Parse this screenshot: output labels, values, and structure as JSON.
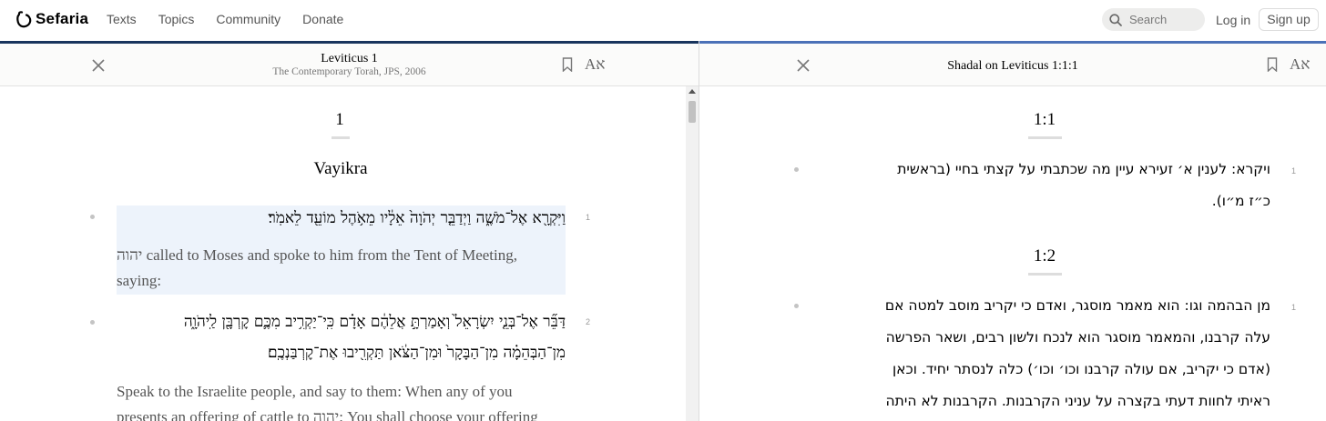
{
  "header": {
    "logo_text": "Sefaria",
    "nav": [
      "Texts",
      "Topics",
      "Community",
      "Donate"
    ],
    "search_placeholder": "Search",
    "login": "Log in",
    "signup": "Sign up"
  },
  "colors": {
    "left_panel_bar": "#18345d",
    "right_panel_bar": "#4b71b7",
    "highlight": "#edf3fb"
  },
  "left_panel": {
    "title": "Leviticus 1",
    "subtitle": "The Contemporary Torah, JPS, 2006",
    "font_toggle": "Aא",
    "section_number": "1",
    "chapter_title": "Vayikra",
    "verses": [
      {
        "num": "1",
        "hebrew": "וַיִּקְרָ֖א אֶל־מֹשֶׁ֑ה וַיְדַבֵּ֤ר יְהֹוָה֙ אֵלָ֔יו מֵאֹ֥הֶל מוֹעֵ֖ד לֵאמֹֽר׃",
        "english_line1": "יהוה called to Moses and spoke to him from the Tent of Meeting,",
        "english_line2": "saying:"
      },
      {
        "num": "2",
        "hebrew_line1": "דַּבֵּ֞ר אֶל־בְּנֵ֤י יִשְׂרָאֵל֙ וְאָמַרְתָּ֣ אֲלֵהֶ֔ם אָדָ֗ם כִּֽי־יַקְרִ֥יב מִכֶּ֛ם קׇרְבָּ֖ן לַֽיהֹוָ֑ה",
        "hebrew_line2": "מִן־הַבְּהֵמָ֗ה מִן־הַבָּקָר֙ וּמִן־הַצֹּ֔אן תַּקְרִ֖יבוּ אֶת־קׇרְבַּנְכֶֽם׃",
        "english_line1": "Speak to the Israelite people, and say to them: When any of you",
        "english_line2": "presents an offering of cattle to יהוה: You shall choose your offering"
      }
    ]
  },
  "right_panel": {
    "title": "Shadal on Leviticus 1:1:1",
    "font_toggle": "Aא",
    "sections": [
      {
        "label": "1:1",
        "comments": [
          {
            "num": "1",
            "line1": "ויקרא: לענין א׳ זעירא עיין מה שכתבתי על קצתי בחיי (בראשית",
            "line2": "כ״ז מ״ו)."
          }
        ]
      },
      {
        "label": "1:2",
        "comments": [
          {
            "num": "1",
            "line1": "מן הבהמה וגו: הוא מאמר מוסגר, ואדם כי יקריב מוסב למטה אם",
            "line2": "עלה קרבנו, והמאמר מוסגר הוא לנכח ולשון רבים, ושאר הפרשה",
            "line3": "(אדם כי יקריב, אם עולה קרבנו וכו׳ וכו׳) כלה לנסתר יחיד. וכאן",
            "line4": "ראיתי לחוות דעתי בקצרה על עניני הקרבנות. הקרבנות לא היתה"
          }
        ]
      }
    ]
  }
}
